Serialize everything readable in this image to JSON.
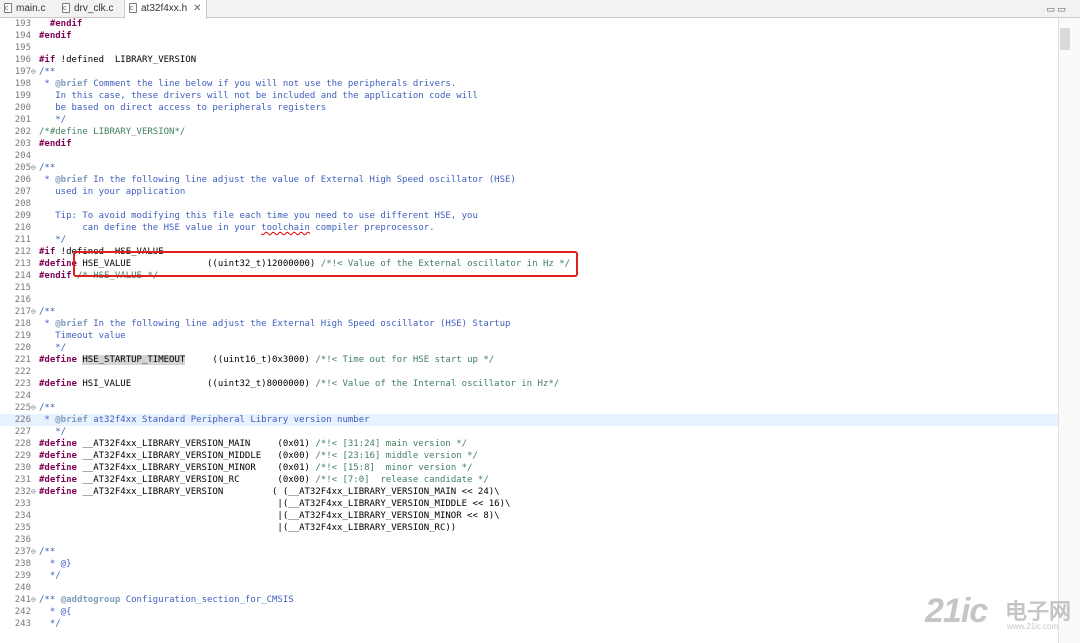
{
  "tabs": [
    {
      "label": "main.c",
      "icon": "c-file-icon",
      "active": false
    },
    {
      "label": "drv_clk.c",
      "icon": "c-file-icon",
      "active": false
    },
    {
      "label": "at32f4xx.h",
      "icon": "c-file-icon",
      "active": true,
      "close": "✕"
    }
  ],
  "window_controls": "▭ ▭",
  "code_lines": [
    {
      "n": "193",
      "f": "",
      "t": "  #endif"
    },
    {
      "n": "194",
      "f": "",
      "t": "#endif"
    },
    {
      "n": "195",
      "f": "",
      "t": ""
    },
    {
      "n": "196",
      "f": "",
      "t": "#if !defined  LIBRARY_VERSION"
    },
    {
      "n": "197",
      "f": "⊖",
      "t": "/**"
    },
    {
      "n": "198",
      "f": "",
      "t": " * @brief Comment the line below if you will not use the peripherals drivers."
    },
    {
      "n": "199",
      "f": "",
      "t": "   In this case, these drivers will not be included and the application code will"
    },
    {
      "n": "200",
      "f": "",
      "t": "   be based on direct access to peripherals registers"
    },
    {
      "n": "201",
      "f": "",
      "t": "   */"
    },
    {
      "n": "202",
      "f": "",
      "t": "/*#define LIBRARY_VERSION*/"
    },
    {
      "n": "203",
      "f": "",
      "t": "#endif"
    },
    {
      "n": "204",
      "f": "",
      "t": ""
    },
    {
      "n": "205",
      "f": "⊖",
      "t": "/**"
    },
    {
      "n": "206",
      "f": "",
      "t": " * @brief In the following line adjust the value of External High Speed oscillator (HSE)"
    },
    {
      "n": "207",
      "f": "",
      "t": "   used in your application"
    },
    {
      "n": "208",
      "f": "",
      "t": ""
    },
    {
      "n": "209",
      "f": "",
      "t": "   Tip: To avoid modifying this file each time you need to use different HSE, you"
    },
    {
      "n": "210",
      "f": "",
      "t": "        can define the HSE value in your toolchain compiler preprocessor."
    },
    {
      "n": "211",
      "f": "",
      "t": "   */"
    },
    {
      "n": "212",
      "f": "",
      "t": "#if !defined  HSE_VALUE"
    },
    {
      "n": "213",
      "f": "",
      "t": "#define HSE_VALUE              ((uint32_t)12000000) /*!< Value of the External oscillator in Hz */"
    },
    {
      "n": "214",
      "f": "",
      "t": "#endif /* HSE_VALUE */"
    },
    {
      "n": "215",
      "f": "",
      "t": ""
    },
    {
      "n": "216",
      "f": "",
      "t": ""
    },
    {
      "n": "217",
      "f": "⊖",
      "t": "/**"
    },
    {
      "n": "218",
      "f": "",
      "t": " * @brief In the following line adjust the External High Speed oscillator (HSE) Startup"
    },
    {
      "n": "219",
      "f": "",
      "t": "   Timeout value"
    },
    {
      "n": "220",
      "f": "",
      "t": "   */"
    },
    {
      "n": "221",
      "f": "",
      "t": "#define HSE_STARTUP_TIMEOUT     ((uint16_t)0x3000) /*!< Time out for HSE start up */"
    },
    {
      "n": "222",
      "f": "",
      "t": ""
    },
    {
      "n": "223",
      "f": "",
      "t": "#define HSI_VALUE              ((uint32_t)8000000) /*!< Value of the Internal oscillator in Hz*/"
    },
    {
      "n": "224",
      "f": "",
      "t": ""
    },
    {
      "n": "225",
      "f": "⊖",
      "t": "/**"
    },
    {
      "n": "226",
      "f": "",
      "t": " * @brief at32f4xx Standard Peripheral Library version number"
    },
    {
      "n": "227",
      "f": "",
      "t": "   */"
    },
    {
      "n": "228",
      "f": "",
      "t": "#define __AT32F4xx_LIBRARY_VERSION_MAIN     (0x01) /*!< [31:24] main version */"
    },
    {
      "n": "229",
      "f": "",
      "t": "#define __AT32F4xx_LIBRARY_VERSION_MIDDLE   (0x00) /*!< [23:16] middle version */"
    },
    {
      "n": "230",
      "f": "",
      "t": "#define __AT32F4xx_LIBRARY_VERSION_MINOR    (0x01) /*!< [15:8]  minor version */"
    },
    {
      "n": "231",
      "f": "",
      "t": "#define __AT32F4xx_LIBRARY_VERSION_RC       (0x00) /*!< [7:0]  release candidate */"
    },
    {
      "n": "232",
      "f": "⊖",
      "t": "#define __AT32F4xx_LIBRARY_VERSION         ( (__AT32F4xx_LIBRARY_VERSION_MAIN << 24)\\"
    },
    {
      "n": "233",
      "f": "",
      "t": "                                            |(__AT32F4xx_LIBRARY_VERSION_MIDDLE << 16)\\"
    },
    {
      "n": "234",
      "f": "",
      "t": "                                            |(__AT32F4xx_LIBRARY_VERSION_MINOR << 8)\\"
    },
    {
      "n": "235",
      "f": "",
      "t": "                                            |(__AT32F4xx_LIBRARY_VERSION_RC))"
    },
    {
      "n": "236",
      "f": "",
      "t": ""
    },
    {
      "n": "237",
      "f": "⊖",
      "t": "/**"
    },
    {
      "n": "238",
      "f": "",
      "t": "  * @}"
    },
    {
      "n": "239",
      "f": "",
      "t": "  */"
    },
    {
      "n": "240",
      "f": "",
      "t": ""
    },
    {
      "n": "241",
      "f": "⊖",
      "t": "/** @addtogroup Configuration_section_for_CMSIS"
    },
    {
      "n": "242",
      "f": "",
      "t": "  * @{"
    },
    {
      "n": "243",
      "f": "",
      "t": "  */"
    }
  ],
  "highlighted_line": "226",
  "selected_word": "HSE_STARTUP_TIMEOUT",
  "watermark": {
    "logo": "21ic",
    "cn": "电子网",
    "url": "www.21ic.com"
  },
  "colors": {
    "keyword": "#7f0055",
    "comment": "#3f7f5f",
    "doc": "#3f5fbf",
    "annotation_box": "#e02020"
  }
}
